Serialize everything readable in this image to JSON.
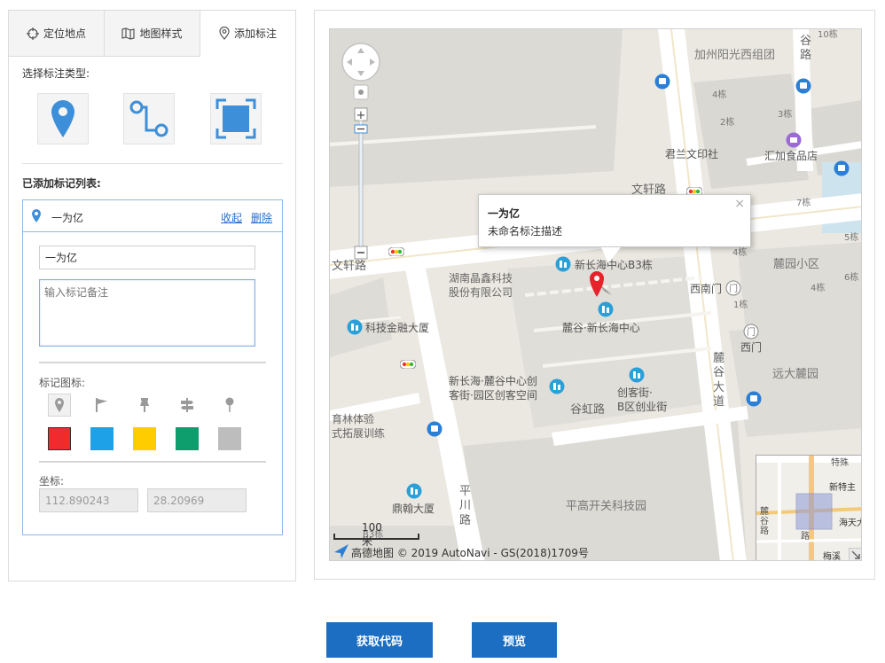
{
  "tabs": [
    {
      "label": "定位地点",
      "icon": "crosshair-icon"
    },
    {
      "label": "地图样式",
      "icon": "map-icon"
    },
    {
      "label": "添加标注",
      "icon": "location-pin-icon",
      "active": true
    }
  ],
  "marker_type": {
    "title": "选择标注类型:",
    "options": [
      "point-marker",
      "polyline",
      "polygon-area"
    ]
  },
  "marker_list": {
    "title": "已添加标记列表:",
    "item": {
      "name": "一为亿",
      "collapse_label": "收起",
      "delete_label": "删除",
      "name_value": "一为亿",
      "note_placeholder": "输入标记备注",
      "icon_label": "标记图标:",
      "icons": [
        "pin-icon",
        "flag-icon",
        "pushpin-icon",
        "signpost-icon",
        "round-pin-icon"
      ],
      "colors": [
        "#ee2b2f",
        "#1fa1e8",
        "#ffcc00",
        "#0e9e6e",
        "#bdbdbd"
      ],
      "coord_label": "坐标:",
      "lng": "112.890243",
      "lat": "28.20969"
    }
  },
  "map": {
    "popup_title": "一为亿",
    "popup_desc": "未命名标注描述",
    "scale": "100 米",
    "copyright": "高德地图 © 2019 AutoNavi - GS(2018)1709号",
    "labels": {
      "jiazhou": "加州阳光西组团",
      "gu_road_v": "谷\n路",
      "junlan": "君兰文印社",
      "huijia": "汇加食品店",
      "wenxuan_road": "文轩路",
      "wenxuan_road2": "文轩路",
      "xinchanghai_b3": "新长海中心B3栋",
      "jingxin": "湖南晶鑫科技\n股份有限公司",
      "kejijinrong": "科技金融大厦",
      "lugu_xinchanghai": "麓谷·新长海中心",
      "xinchanghai_lugu": "新长海·麓谷中心创\n客街·园区创客空间",
      "chuangke": "创客街·\nB区创业街",
      "guhong_road": "谷虹路",
      "yulin": "育林体验\n式拓展训练",
      "dinghan": "鼎翰大厦",
      "pingchuan_road": "平\n川\n路",
      "pinggao": "平高开关科技园",
      "xinanmen": "西南门",
      "ximen": "西门",
      "luyuan": "麓园小区",
      "yuanlu": "远大麓园",
      "lugu_avenue": "麓\n谷\n大\n道",
      "b4": "4栋",
      "b2": "2栋",
      "b3": "3栋",
      "b7": "7栋",
      "b5": "5栋",
      "b4b": "4栋",
      "b6": "6栋",
      "b4c": "4栋",
      "b1": "1栋",
      "b10": "10栋",
      "b3b": "B3栋",
      "ov_xintezhu": "新特主",
      "ov_haitianda": "海天大",
      "ov_lugu": "麓谷路",
      "ov_meixi": "梅溪",
      "ov_tebie": "特殊",
      "ov_road": "路"
    }
  },
  "buttons": {
    "get_code": "获取代码",
    "preview": "预览"
  }
}
